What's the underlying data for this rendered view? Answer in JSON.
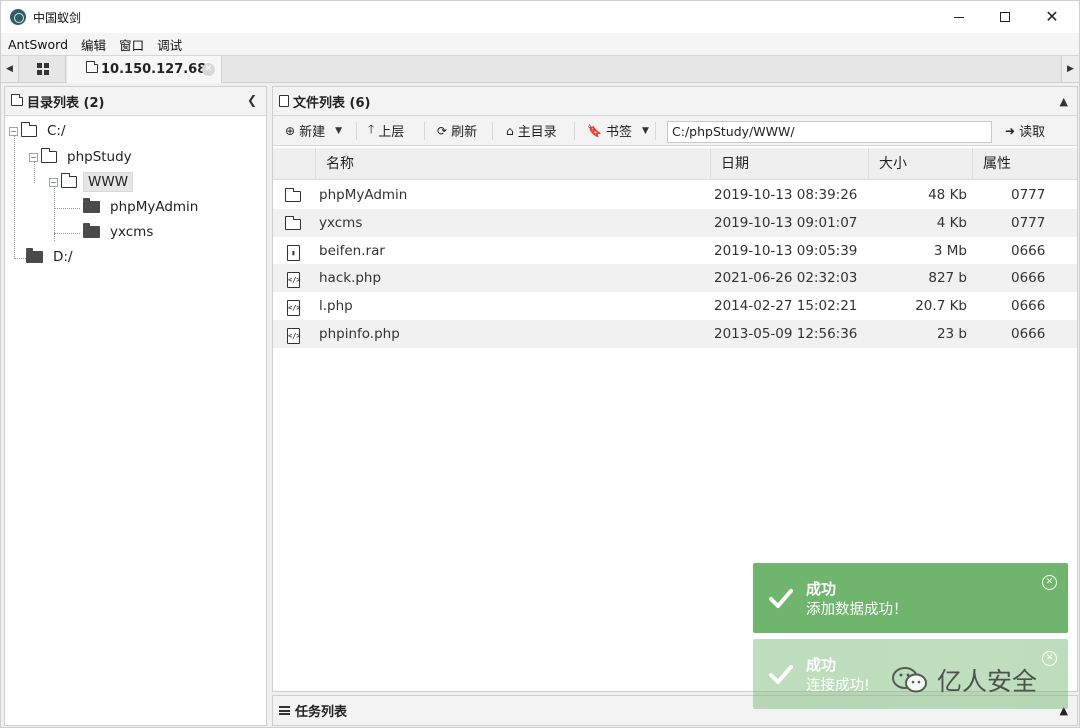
{
  "window": {
    "title": "中国蚁剑"
  },
  "menu": [
    "AntSword",
    "编辑",
    "窗口",
    "调试"
  ],
  "tabs": {
    "active_tab": "10.150.127.68"
  },
  "dir_panel": {
    "title": "目录列表 (2)",
    "tree": {
      "c_drive": "C:/",
      "phpstudy": "phpStudy",
      "www": "WWW",
      "phpmyadmin": "phpMyAdmin",
      "yxcms": "yxcms",
      "d_drive": "D:/"
    }
  },
  "file_panel": {
    "title": "文件列表 (6)",
    "toolbar": {
      "new": "新建",
      "up": "上层",
      "refresh": "刷新",
      "home": "主目录",
      "bookmark": "书签",
      "path": "C:/phpStudy/WWW/",
      "read": "读取"
    },
    "columns": {
      "name": "名称",
      "date": "日期",
      "size": "大小",
      "attr": "属性"
    },
    "files": [
      {
        "icon": "folder-icon",
        "name": "phpMyAdmin",
        "date": "2019-10-13 08:39:26",
        "size": "48 Kb",
        "attr": "0777"
      },
      {
        "icon": "folder-icon",
        "name": "yxcms",
        "date": "2019-10-13 09:01:07",
        "size": "4 Kb",
        "attr": "0777"
      },
      {
        "icon": "archive-file-icon",
        "name": "beifen.rar",
        "date": "2019-10-13 09:05:39",
        "size": "3 Mb",
        "attr": "0666"
      },
      {
        "icon": "code-file-icon",
        "name": "hack.php",
        "date": "2021-06-26 02:32:03",
        "size": "827 b",
        "attr": "0666"
      },
      {
        "icon": "code-file-icon",
        "name": "l.php",
        "date": "2014-02-27 15:02:21",
        "size": "20.7 Kb",
        "attr": "0666"
      },
      {
        "icon": "code-file-icon",
        "name": "phpinfo.php",
        "date": "2013-05-09 12:56:36",
        "size": "23 b",
        "attr": "0666"
      }
    ]
  },
  "task_panel": {
    "title": "任务列表"
  },
  "toasts": [
    {
      "title": "成功",
      "message": "添加数据成功！"
    },
    {
      "title": "成功",
      "message": "连接成功!"
    }
  ],
  "watermark": {
    "text": "亿人安全"
  },
  "colors": {
    "toast_success": "#6fb56e",
    "alt_row": "#f1f1f1"
  }
}
